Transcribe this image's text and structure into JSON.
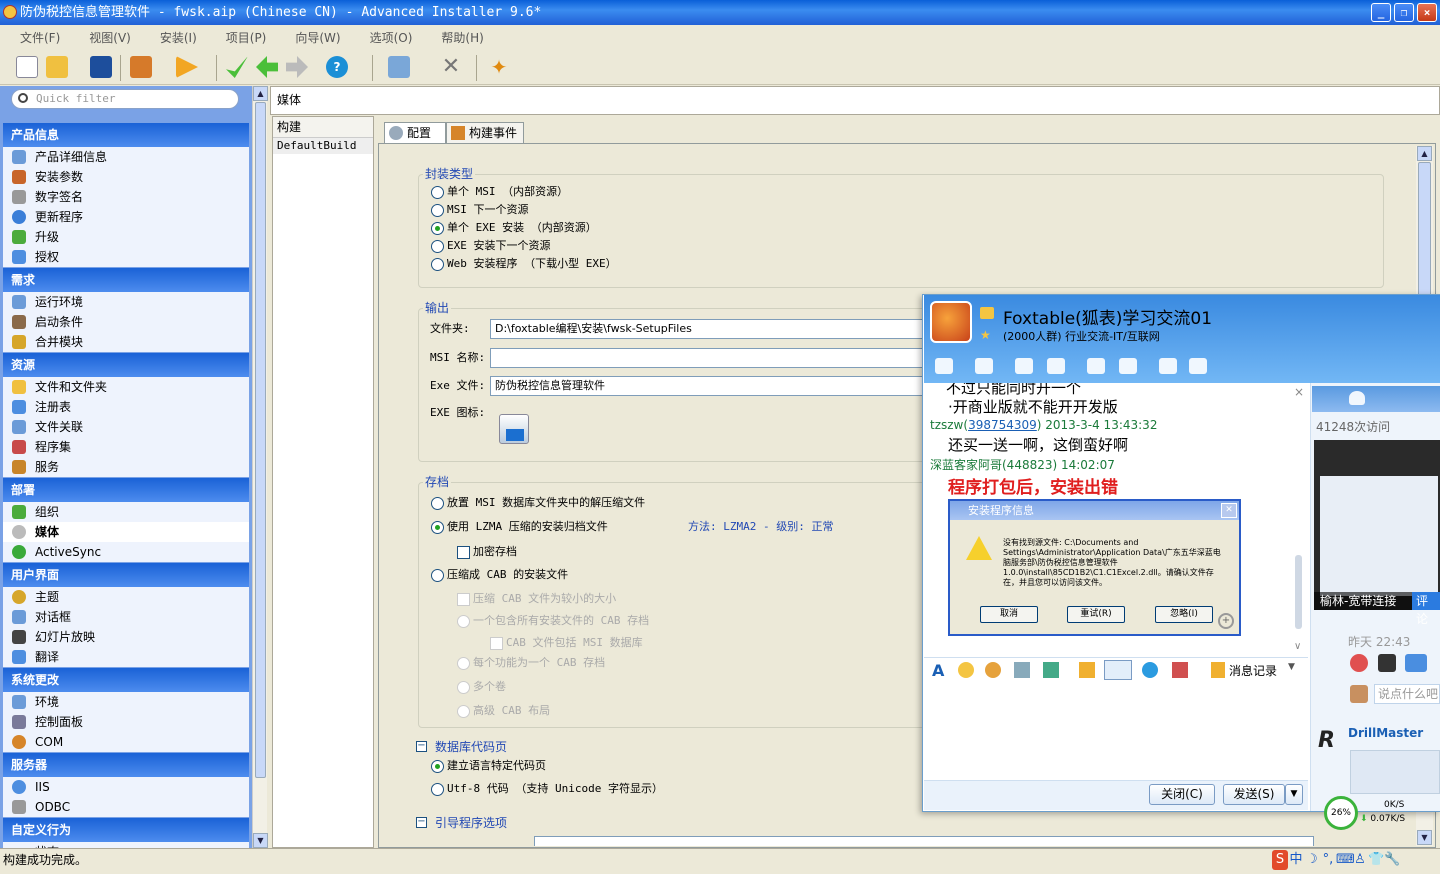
{
  "window": {
    "title": "防伪税控信息管理软件 - fwsk.aip (Chinese CN) - Advanced Installer 9.6*"
  },
  "menu": [
    "文件(F)",
    "视图(V)",
    "安装(I)",
    "项目(P)",
    "向导(W)",
    "选项(O)",
    "帮助(H)"
  ],
  "filter": {
    "placeholder": "Quick filter"
  },
  "nav": [
    {
      "group": "产品信息",
      "items": [
        "产品详细信息",
        "安装参数",
        "数字签名",
        "更新程序",
        "升级",
        "授权"
      ]
    },
    {
      "group": "需求",
      "items": [
        "运行环境",
        "启动条件",
        "合并模块"
      ]
    },
    {
      "group": "资源",
      "items": [
        "文件和文件夹",
        "注册表",
        "文件关联",
        "程序集",
        "服务"
      ]
    },
    {
      "group": "部署",
      "items": [
        "组织",
        "媒体",
        "ActiveSync"
      ]
    },
    {
      "group": "用户界面",
      "items": [
        "主题",
        "对话框",
        "幻灯片放映",
        "翻译"
      ]
    },
    {
      "group": "系统更改",
      "items": [
        "环境",
        "控制面板",
        "COM"
      ]
    },
    {
      "group": "服务器",
      "items": [
        "IIS",
        "ODBC"
      ]
    },
    {
      "group": "自定义行为",
      "items": [
        "状态"
      ]
    }
  ],
  "nav_selected": "媒体",
  "header": {
    "title": "媒体"
  },
  "builds": {
    "header": "构建",
    "rows": [
      "DefaultBuild"
    ]
  },
  "tabs": [
    "配置",
    "构建事件"
  ],
  "package": {
    "legend": "封装类型",
    "options": [
      "单个 MSI （内部资源）",
      "MSI 下一个资源",
      "单个 EXE 安装 （内部资源）",
      "EXE 安装下一个资源",
      "Web 安装程序 （下载小型 EXE）"
    ],
    "selected": 2
  },
  "output": {
    "legend": "输出",
    "folder_label": "文件夹:",
    "folder_value": "D:\\foxtable编程\\安装\\fwsk-SetupFiles",
    "msi_label": "MSI 名称:",
    "msi_value": "",
    "exe_label": "Exe 文件:",
    "exe_value": "防伪税控信息管理软件",
    "icon_label": "EXE 图标:"
  },
  "archive": {
    "legend": "存档",
    "opt1": "放置 MSI 数据库文件夹中的解压缩文件",
    "opt2": "使用 LZMA 压缩的安装归档文件",
    "method": "方法: LZMA2 - 级别: 正常",
    "encrypt": "加密存档",
    "opt3": "压缩成 CAB 的安装文件",
    "cab_small": "压缩 CAB 文件为较小的大小",
    "cab_one": "一个包含所有安装文件的 CAB 存档",
    "cab_msi": "CAB 文件包括 MSI 数据库",
    "cab_each": "每个功能为一个 CAB 存档",
    "multi": "多个卷",
    "advanced": "高级 CAB 布局"
  },
  "codepage": {
    "legend": "数据库代码页",
    "opt1": "建立语言特定代码页",
    "opt2": "Utf-8 代码 （支持 Unicode 字符显示）"
  },
  "bootstrap": {
    "legend": "引导程序选项"
  },
  "status": "构建成功完成。",
  "tray": [
    "中",
    "☽",
    "°,",
    "⌨",
    "♙",
    "👕",
    "🔧"
  ],
  "qq": {
    "title": "Foxtable(狐表)学习交流01",
    "subtitle": "(2000人群) 行业交流-IT/互联网",
    "msg0": "不过只能同时开一个",
    "msg1": "开商业版就不能开开发版",
    "user2": "tzszw(",
    "user2id": "398754309",
    "user2time": ") 2013-3-4 13:43:32",
    "msg2": "还买一送一啊，这倒蛮好啊",
    "user3": "深蓝客家阿哥(448823)  14:02:07",
    "msg3": "程序打包后，安装出错",
    "dialog": {
      "title": "安装程序信息",
      "text": "没有找到源文件: C:\\Documents and Settings\\Administrator\\Application Data\\广东五华深蓝电脑服务部\\防伪税控信息管理软件 1.0.0\\install\\85CD1B2\\C1.C1Excel.2.dll。请确认文件存在，并且您可以访问该文件。",
      "cancel": "取消",
      "retry": "重试(R)",
      "ignore": "忽略(I)"
    },
    "history": "消息记录",
    "close": "关闭(C)",
    "send": "发送(S)",
    "visits": "41248次访问",
    "shot_caption": "榆林-宽带连接",
    "shot_button": "评论",
    "side_time": "昨天 22:43",
    "side_input": "说点什么吧...",
    "drill": "DrillMaster",
    "net_pct": "26%",
    "up": "0K/S",
    "down": "0.07K/S"
  }
}
